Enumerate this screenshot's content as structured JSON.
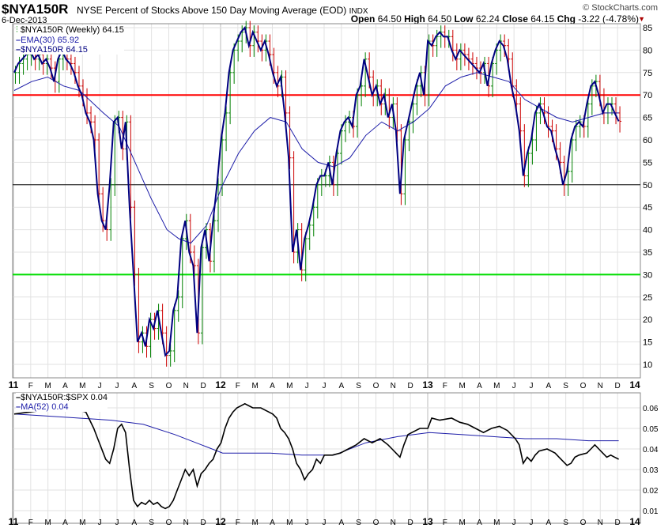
{
  "header": {
    "symbol": "$NYA150R",
    "description": "NYSE Percent of Stocks Above 150 Day Moving Average (EOD)",
    "exchange": "INDX",
    "date": "6-Dec-2013",
    "brand": "© StockCharts.com",
    "open_label": "Open",
    "open": "64.50",
    "high_label": "High",
    "high": "64.50",
    "low_label": "Low",
    "low": "62.24",
    "close_label": "Close",
    "close": "64.15",
    "chg_label": "Chg",
    "chg": "-3.22 (-4.78%)"
  },
  "colors": {
    "price": "#000080",
    "ema": "#1c1ca8",
    "up": "#008000",
    "down": "#cc0000",
    "line70": "#ff0000",
    "line50": "#000000",
    "line30": "#00dd00",
    "ratio": "#000000",
    "ma": "#1c1ca8"
  },
  "chart_data": [
    {
      "type": "line",
      "title": "$NYA150R (Weekly) 64.15",
      "legend": [
        "$NYA150R (Weekly) 64.15",
        "EMA(30) 65.92",
        "$NYA150R 64.15"
      ],
      "ylim": [
        7,
        86
      ],
      "yticks": [
        10,
        15,
        20,
        25,
        30,
        35,
        40,
        45,
        50,
        55,
        60,
        65,
        70,
        75,
        80,
        85
      ],
      "hlines": [
        70,
        50,
        30
      ],
      "x_unit": "weeks since Jan 2011",
      "close": [
        75,
        77,
        78,
        79,
        80,
        78,
        79,
        77,
        78,
        76,
        73,
        78,
        80,
        78,
        77,
        75,
        72,
        70,
        66,
        64,
        60,
        48,
        42,
        40,
        50,
        64,
        65,
        58,
        64,
        45,
        30,
        15,
        17,
        14,
        20,
        18,
        22,
        17,
        12,
        13,
        22,
        25,
        38,
        42,
        35,
        32,
        17,
        36,
        40,
        33,
        42,
        50,
        60,
        66,
        75,
        80,
        82,
        84,
        85,
        81,
        84,
        82,
        80,
        82,
        79,
        75,
        72,
        74,
        66,
        56,
        35,
        40,
        31,
        38,
        41,
        45,
        50,
        52,
        52,
        55,
        50,
        57,
        62,
        64,
        65,
        63,
        70,
        72,
        78,
        74,
        70,
        72,
        68,
        70,
        65,
        68,
        62,
        48,
        60,
        64,
        68,
        72,
        75,
        70,
        82,
        81,
        83,
        84,
        83,
        83,
        80,
        78,
        80,
        79,
        78,
        77,
        76,
        75,
        77,
        72,
        77,
        80,
        82,
        81,
        78,
        72,
        68,
        62,
        52,
        57,
        60,
        66,
        68,
        66,
        63,
        62,
        58,
        55,
        50,
        53,
        60,
        63,
        64,
        63,
        68,
        72,
        73,
        70,
        66,
        68,
        68,
        66,
        64.15
      ],
      "ema30": [
        [
          0,
          71
        ],
        [
          4.4,
          73
        ],
        [
          8.4,
          74
        ],
        [
          12.4,
          72
        ],
        [
          16.4,
          71
        ],
        [
          22.4,
          66
        ],
        [
          26.4,
          63
        ],
        [
          30.4,
          55
        ],
        [
          34.4,
          47
        ],
        [
          38.4,
          40
        ],
        [
          41.4,
          38
        ],
        [
          44.4,
          37
        ],
        [
          48.4,
          41
        ],
        [
          52.4,
          50
        ],
        [
          56.4,
          57
        ],
        [
          60.4,
          62
        ],
        [
          64.4,
          65
        ],
        [
          68.4,
          64
        ],
        [
          72.4,
          58
        ],
        [
          76.4,
          55
        ],
        [
          80.4,
          54
        ],
        [
          84.4,
          56
        ],
        [
          88.4,
          61
        ],
        [
          92.4,
          64
        ],
        [
          96.4,
          62
        ],
        [
          100.4,
          64
        ],
        [
          104.4,
          67
        ],
        [
          108.4,
          72
        ],
        [
          112.4,
          74
        ],
        [
          116.4,
          75
        ],
        [
          120.4,
          74
        ],
        [
          124.4,
          73
        ],
        [
          128.4,
          69
        ],
        [
          132.4,
          67
        ],
        [
          136.4,
          65
        ],
        [
          140.4,
          64
        ],
        [
          144.4,
          65
        ],
        [
          148.4,
          66
        ],
        [
          152,
          66
        ]
      ]
    },
    {
      "type": "line",
      "title": "$NYA150R:$SPX 0.04",
      "legend": [
        "$NYA150R:$SPX 0.04",
        "MA(52) 0.04"
      ],
      "ylim": [
        0.005,
        0.066
      ],
      "yticks": [
        0.01,
        0.02,
        0.03,
        0.04,
        0.05,
        0.06
      ],
      "ratio": [
        [
          0,
          0.057
        ],
        [
          8,
          0.059
        ],
        [
          14,
          0.06
        ],
        [
          18,
          0.058
        ],
        [
          20,
          0.05
        ],
        [
          21,
          0.045
        ],
        [
          23,
          0.035
        ],
        [
          24,
          0.033
        ],
        [
          25,
          0.04
        ],
        [
          26,
          0.05
        ],
        [
          27,
          0.052
        ],
        [
          28,
          0.048
        ],
        [
          29,
          0.03
        ],
        [
          30,
          0.015
        ],
        [
          31,
          0.012
        ],
        [
          32,
          0.014
        ],
        [
          33,
          0.013
        ],
        [
          34,
          0.015
        ],
        [
          35,
          0.013
        ],
        [
          36,
          0.014
        ],
        [
          37,
          0.012
        ],
        [
          38,
          0.011
        ],
        [
          39,
          0.012
        ],
        [
          40,
          0.015
        ],
        [
          41,
          0.02
        ],
        [
          42,
          0.025
        ],
        [
          43,
          0.03
        ],
        [
          44,
          0.027
        ],
        [
          45,
          0.03
        ],
        [
          46,
          0.022
        ],
        [
          47,
          0.028
        ],
        [
          48,
          0.03
        ],
        [
          49,
          0.033
        ],
        [
          50,
          0.035
        ],
        [
          51,
          0.04
        ],
        [
          52,
          0.043
        ],
        [
          53,
          0.05
        ],
        [
          54,
          0.055
        ],
        [
          55,
          0.058
        ],
        [
          56,
          0.06
        ],
        [
          57,
          0.061
        ],
        [
          58,
          0.062
        ],
        [
          59,
          0.061
        ],
        [
          60,
          0.06
        ],
        [
          62,
          0.06
        ],
        [
          64,
          0.058
        ],
        [
          65,
          0.057
        ],
        [
          66,
          0.055
        ],
        [
          67,
          0.05
        ],
        [
          68,
          0.048
        ],
        [
          69,
          0.045
        ],
        [
          70,
          0.04
        ],
        [
          71,
          0.033
        ],
        [
          72,
          0.03
        ],
        [
          73,
          0.025
        ],
        [
          74,
          0.028
        ],
        [
          75,
          0.03
        ],
        [
          76,
          0.035
        ],
        [
          77,
          0.033
        ],
        [
          78,
          0.037
        ],
        [
          80,
          0.037
        ],
        [
          82,
          0.038
        ],
        [
          84,
          0.04
        ],
        [
          86,
          0.042
        ],
        [
          88,
          0.045
        ],
        [
          90,
          0.043
        ],
        [
          92,
          0.045
        ],
        [
          94,
          0.042
        ],
        [
          95,
          0.04
        ],
        [
          96,
          0.038
        ],
        [
          97,
          0.036
        ],
        [
          98,
          0.042
        ],
        [
          99,
          0.047
        ],
        [
          100,
          0.048
        ],
        [
          102,
          0.05
        ],
        [
          104,
          0.05
        ],
        [
          105,
          0.055
        ],
        [
          107,
          0.054
        ],
        [
          110,
          0.055
        ],
        [
          112,
          0.053
        ],
        [
          114,
          0.052
        ],
        [
          116,
          0.05
        ],
        [
          118,
          0.048
        ],
        [
          120,
          0.05
        ],
        [
          122,
          0.051
        ],
        [
          124,
          0.049
        ],
        [
          126,
          0.045
        ],
        [
          127,
          0.042
        ],
        [
          128,
          0.033
        ],
        [
          129,
          0.036
        ],
        [
          130,
          0.034
        ],
        [
          131,
          0.037
        ],
        [
          132,
          0.039
        ],
        [
          134,
          0.04
        ],
        [
          136,
          0.038
        ],
        [
          137,
          0.036
        ],
        [
          138,
          0.034
        ],
        [
          139,
          0.032
        ],
        [
          140,
          0.033
        ],
        [
          141,
          0.036
        ],
        [
          142,
          0.037
        ],
        [
          144,
          0.038
        ],
        [
          145,
          0.04
        ],
        [
          146,
          0.042
        ],
        [
          147,
          0.04
        ],
        [
          148,
          0.038
        ],
        [
          149,
          0.036
        ],
        [
          150,
          0.037
        ],
        [
          151,
          0.036
        ],
        [
          152,
          0.035
        ]
      ],
      "ma52": [
        [
          0,
          0.057
        ],
        [
          8.4,
          0.056
        ],
        [
          16.4,
          0.055
        ],
        [
          24.4,
          0.054
        ],
        [
          32.4,
          0.052
        ],
        [
          40.4,
          0.047
        ],
        [
          48.4,
          0.041
        ],
        [
          52.4,
          0.038
        ],
        [
          56.4,
          0.038
        ],
        [
          64.4,
          0.038
        ],
        [
          72.4,
          0.037
        ],
        [
          80.4,
          0.037
        ],
        [
          88.4,
          0.043
        ],
        [
          96.4,
          0.046
        ],
        [
          104.4,
          0.048
        ],
        [
          112.4,
          0.047
        ],
        [
          120.4,
          0.046
        ],
        [
          128.4,
          0.045
        ],
        [
          136.4,
          0.045
        ],
        [
          144.4,
          0.044
        ],
        [
          152,
          0.044
        ]
      ]
    }
  ],
  "xaxis": {
    "years": [
      "11",
      "12",
      "13",
      "14"
    ],
    "months": [
      "F",
      "M",
      "A",
      "M",
      "J",
      "J",
      "A",
      "S",
      "O",
      "N",
      "D"
    ]
  }
}
